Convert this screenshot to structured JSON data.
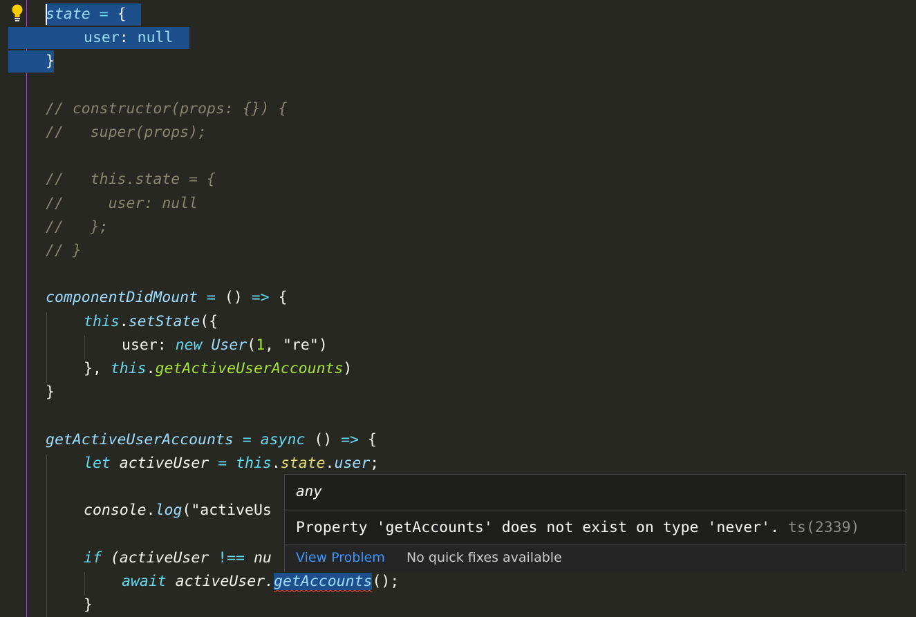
{
  "editor": {
    "lines": {
      "l1": {
        "state": "state",
        "eq": " = ",
        "brace": "{"
      },
      "l2": {
        "key": "user",
        "colon": ": ",
        "val": "null"
      },
      "l3": {
        "brace": "}"
      },
      "l5": "// constructor(props: {}) {",
      "l6": "//   super(props);",
      "l8": "//   this.state = {",
      "l9": "//     user: null",
      "l10": "//   };",
      "l11": "// }",
      "l13": {
        "name": "componentDidMount",
        "eq": " = ",
        "parens": "()",
        "arrow": " => ",
        "brace": "{"
      },
      "l14": {
        "this": "this",
        "dot": ".",
        "fn": "setState",
        "rest": "({"
      },
      "l15": {
        "key": "user: ",
        "new": "new",
        "cls": "User",
        "open": "(",
        "num": "1",
        "comma": ", ",
        "str": "\"re\"",
        "close": ")"
      },
      "l16": {
        "pre": "}, ",
        "this": "this",
        "dot": ".",
        "fn": "getActiveUserAccounts",
        "close": ")"
      },
      "l17": {
        "brace": "}"
      },
      "l19": {
        "name": "getActiveUserAccounts",
        "eq": " = ",
        "async": "async",
        "parens": " ()",
        "arrow": " => ",
        "brace": "{"
      },
      "l20": {
        "let": "let",
        "var": " activeUser ",
        "eq": "= ",
        "this": "this",
        "dot1": ".",
        "state": "state",
        "dot2": ".",
        "user": "user",
        "semi": ";"
      },
      "l22": {
        "obj": "console",
        "dot": ".",
        "fn": "log",
        "rest": "(\"activeUs"
      },
      "l24": {
        "if": "if",
        "rest": " (activeUser ",
        "op": "!==",
        "rest2": " nu"
      },
      "l25": {
        "await": "await",
        "var": " activeUser.",
        "fn": "getAccounts",
        "rest": "();"
      },
      "l26": {
        "brace": "}"
      }
    }
  },
  "hover": {
    "type": "any",
    "message": "Property 'getAccounts' does not exist on type 'never'.",
    "code": "ts(2339)",
    "view_problem": "View Problem",
    "no_fixes": "No quick fixes available"
  }
}
